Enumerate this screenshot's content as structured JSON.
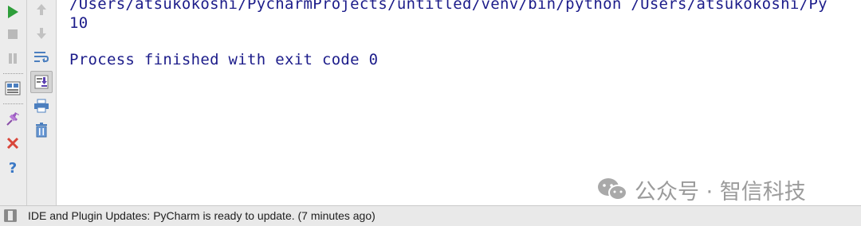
{
  "console": {
    "lines": [
      "/Users/atsukokoshi/PycharmProjects/untitled/venv/bin/python /Users/atsukokoshi/Py",
      "10",
      "",
      "Process finished with exit code 0"
    ]
  },
  "left_toolbar": {
    "icons": [
      "run-icon",
      "stop-icon",
      "pause-icon",
      "restore-layout-icon",
      "pin-icon",
      "close-icon",
      "help-icon"
    ]
  },
  "right_toolbar": {
    "icons": [
      "up-arrow-icon",
      "down-arrow-icon",
      "soft-wrap-icon",
      "scroll-to-end-icon",
      "print-icon",
      "trash-icon"
    ]
  },
  "statusbar": {
    "message": "IDE and Plugin Updates: PyCharm is ready to update. (7 minutes ago)"
  },
  "watermark": {
    "text": "公众号 · 智信科技"
  },
  "colors": {
    "console_text": "#1c1c8a",
    "run_green": "#2e9e3a",
    "close_red": "#d9463a",
    "help_blue": "#3a78c6"
  }
}
